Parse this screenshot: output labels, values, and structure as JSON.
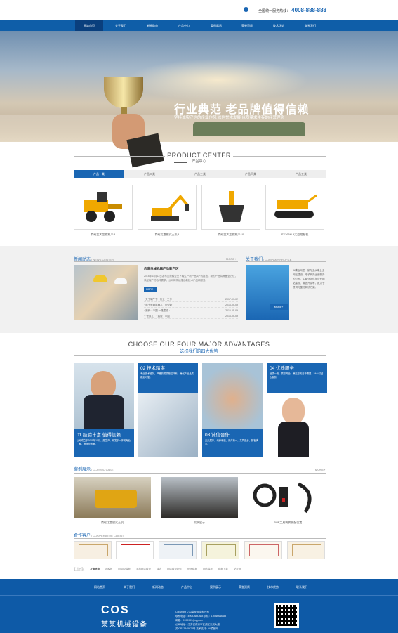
{
  "header": {
    "phone_label": "全国统一服务热线：",
    "phone_number": "4008-888-888",
    "phone_icon": "phone-icon"
  },
  "nav": [
    "网站首页",
    "关于我们",
    "新闻动态",
    "产品中心",
    "案例展示",
    "荣誉资质",
    "技术优势",
    "联系我们"
  ],
  "hero": {
    "title": "行业典范 老品牌值得信赖",
    "subtitle": "坚持诚实守信的企业作风 以信誉求发展 以质量求生存的经营理念"
  },
  "products": {
    "title_en": "PRODUCT CENTER",
    "title_cn": "产品中心",
    "tabs": [
      "产品一类",
      "产品二类",
      "产品三类",
      "产品四类",
      "产品五类"
    ],
    "items": [
      "商砼比大型挖机半B",
      "商砼比重履式土机B",
      "商砼比大型挖机半10",
      "SY365H-9大型挖掘机"
    ]
  },
  "news": {
    "title": "新闻动态",
    "title_en": "/ NEWS CENTER",
    "more": "MORE+",
    "top_title": "启道良械机器产品新产区",
    "top_desc": "2016年11月12日发布大规模企业下线生产新产品A产的推出，新的产品将具备全方位，满足客户的各种需求，公司将持续推出新技术产品和服务。",
    "more_btn": "MORE+",
    "list": [
      {
        "title": "· 关于端午节 · 行业 · 工作",
        "date": "2017-01-02"
      },
      {
        "title": "· 商土是路机器人 · 类型新",
        "date": "2016-05-09"
      },
      {
        "title": "· 案例：中国 一路建设 · ",
        "date": "2016-05-09"
      },
      {
        "title": "· \"世界工厂\" 建设 · 中国",
        "date": "2016-05-09"
      }
    ]
  },
  "about": {
    "title": "关于我们",
    "title_en": "/ COMPANY PROFILE",
    "text": "AI模板网是一家专业从事企业网站建设，电子商务运营服务的公司，主要业务包括企业网站建设、微信开发等，致力于提供完整的解决方案。",
    "more_btn": "MORE+"
  },
  "advantages": {
    "title_en": "CHOOSE OUR FOUR MAJOR ADVANTAGES",
    "title_cn": "选择我们的四大优势",
    "items": [
      {
        "title": "01 经验丰富 值得信赖",
        "desc": "公司成立于2005年10月，是生产、研发于一体的专业厂家，值得您信赖。"
      },
      {
        "title": "02 技术精湛",
        "desc": "专业技术团队，严格的质量把控体系，确保产品品质稳定可靠。"
      },
      {
        "title": "03 诚信合作",
        "desc": "天天展厅，培养和谐，用户第一，共同进步，顾客满意。"
      },
      {
        "title": "04 优质服务",
        "desc": "品质一流，质量齐全，满足您的各种需要，24小时贴心服务。"
      }
    ]
  },
  "cases": {
    "title": "案例展示",
    "title_en": "/ CLASSIC CASE",
    "more": "MORE+",
    "items": [
      "商砼比重履式土机",
      "案例展示",
      "SMF工具快换钢配位置"
    ]
  },
  "partners": {
    "title": "合作客户",
    "title_en": "/ COOPERATIVE CLIENT"
  },
  "links": {
    "label": "Link",
    "sub": "友情链接",
    "items": [
      "AI模板",
      "Discuz模板",
      "手机网站建设",
      "建站",
      "网站建设制作",
      "织梦模板",
      "网站模板",
      "模板下载",
      "站长网"
    ]
  },
  "footer": {
    "nav": [
      "网站首页",
      "关于我们",
      "新闻动态",
      "产品中心",
      "案例展示",
      "荣誉资质",
      "技术优势",
      "联系我们"
    ],
    "logo_en": "COS",
    "logo_cn": "某某机械设备",
    "info": [
      "Copyright © AI模板网 版权所有",
      "联系电话：4008-888-888 手机：13988888888",
      "邮箱：9999999@qq.com",
      "公司地址：江苏省南京市玄武区玄武大道",
      "苏ICP12345678号 技术支持：AI模板网"
    ]
  }
}
